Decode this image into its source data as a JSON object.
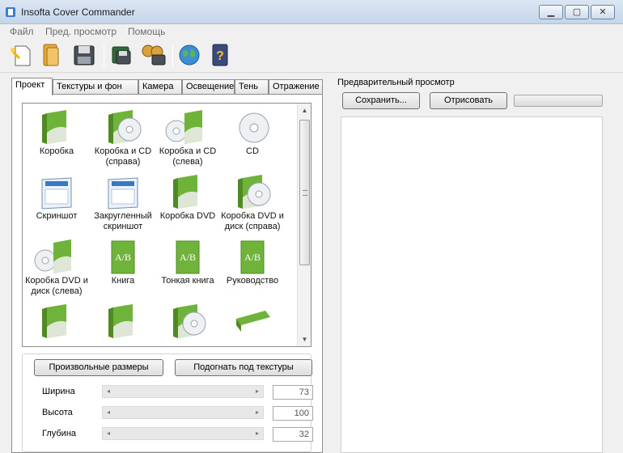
{
  "window": {
    "title": "Insofta Cover Commander"
  },
  "menu": [
    "Файл",
    "Пред. просмотр",
    "Помощь"
  ],
  "toolbar": {
    "buttons": [
      "new-project-icon",
      "open-folder-icon",
      "save-floppy-icon",
      "batch-save-icon",
      "export-video-icon",
      "web-globe-icon",
      "help-book-icon"
    ]
  },
  "tabs": [
    "Проект",
    "Текстуры и фон",
    "Камера",
    "Освещение",
    "Тень",
    "Отражение"
  ],
  "gallery": {
    "items": [
      {
        "label": "Коробка",
        "icon": "box-icon"
      },
      {
        "label": "Коробка и CD (справа)",
        "icon": "box-cd-right-icon"
      },
      {
        "label": "Коробка и CD (слева)",
        "icon": "box-cd-left-icon"
      },
      {
        "label": "CD",
        "icon": "cd-icon"
      },
      {
        "label": "Скриншот",
        "icon": "screenshot-icon"
      },
      {
        "label": "Закругленный скриншот",
        "icon": "rounded-screenshot-icon"
      },
      {
        "label": "Коробка DVD",
        "icon": "dvd-box-icon"
      },
      {
        "label": "Коробка DVD и диск (справа)",
        "icon": "dvd-box-disc-right-icon"
      },
      {
        "label": "Коробка DVD и диск (слева)",
        "icon": "dvd-box-disc-left-icon"
      },
      {
        "label": "Книга",
        "icon": "book-icon"
      },
      {
        "label": "Тонкая книга",
        "icon": "thin-book-icon"
      },
      {
        "label": "Руководство",
        "icon": "manual-icon"
      },
      {
        "label": "",
        "icon": "box-alt-icon"
      },
      {
        "label": "",
        "icon": "box-alt2-icon"
      },
      {
        "label": "",
        "icon": "box-disc-alt-icon"
      },
      {
        "label": "",
        "icon": "flat-box-icon"
      }
    ]
  },
  "size_buttons": {
    "custom": "Произвольные размеры",
    "fit": "Подогнать под текстуры"
  },
  "dimensions": [
    {
      "label": "Ширина",
      "value": "73"
    },
    {
      "label": "Высота",
      "value": "100"
    },
    {
      "label": "Глубина",
      "value": "32"
    }
  ],
  "preview": {
    "title": "Предварительный просмотр",
    "save_label": "Сохранить...",
    "render_label": "Отрисовать"
  },
  "colors": {
    "accent_green": "#6fb33a",
    "titlebar": "#c5d6ea"
  }
}
